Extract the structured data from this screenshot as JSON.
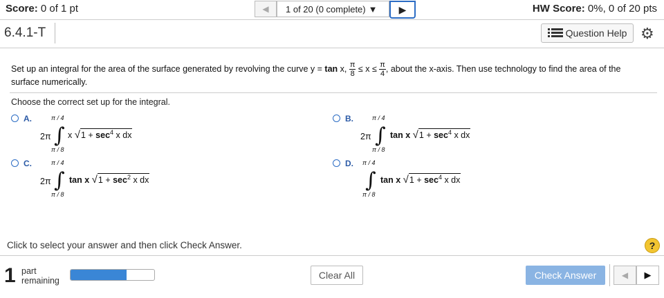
{
  "header": {
    "score_label": "Score:",
    "score_value": "0 of 1 pt",
    "question_selector": "1 of 20 (0 complete)",
    "hw_score_label": "HW Score:",
    "hw_score_value": "0%, 0 of 20 pts"
  },
  "title": {
    "question_id": "6.4.1-T",
    "help_label": "Question Help"
  },
  "question": {
    "line1_a": "Set up an integral for the area of the surface generated by revolving the curve y = ",
    "line1_tan": "tan",
    "line1_b": " x, ",
    "frac1_num": "π",
    "frac1_den": "8",
    "le1": " ≤ x ≤ ",
    "frac2_num": "π",
    "frac2_den": "4",
    "line1_c": ", about the x-axis. Then use technology to find the area of the",
    "line2": "surface numerically.",
    "choose": "Choose the correct set up for the integral."
  },
  "options": [
    {
      "label": "A.",
      "coef": "2π",
      "upper": "π / 4",
      "lower": "π / 8",
      "pre": "x",
      "exp": "4"
    },
    {
      "label": "B.",
      "coef": "2π",
      "upper": "π / 4",
      "lower": "π / 8",
      "pre": "tan x",
      "exp": "4"
    },
    {
      "label": "C.",
      "coef": "2π",
      "upper": "π / 4",
      "lower": "π / 8",
      "pre": "tan x",
      "exp": "2"
    },
    {
      "label": "D.",
      "coef": "",
      "upper": "π / 4",
      "lower": "π / 8",
      "pre": "tan x",
      "exp": "4"
    }
  ],
  "math": {
    "sqrt_inner": "1 + ",
    "sec": "sec",
    "tail": " x dx"
  },
  "footer": {
    "instruction": "Click to select your answer and then click Check Answer.",
    "parts_number": "1",
    "parts_line1": "part",
    "parts_line2": "remaining",
    "progress": 0.67,
    "clear_label": "Clear All",
    "check_label": "Check Answer"
  },
  "colors": {
    "accent": "#2b6cc4",
    "check_button": "#8ab4e3",
    "progress_fill": "#3a86d6"
  },
  "icons": [
    "triangle-left-icon",
    "triangle-right-icon",
    "dropdown-arrow-icon",
    "list-icon",
    "gear-icon",
    "help-icon"
  ]
}
